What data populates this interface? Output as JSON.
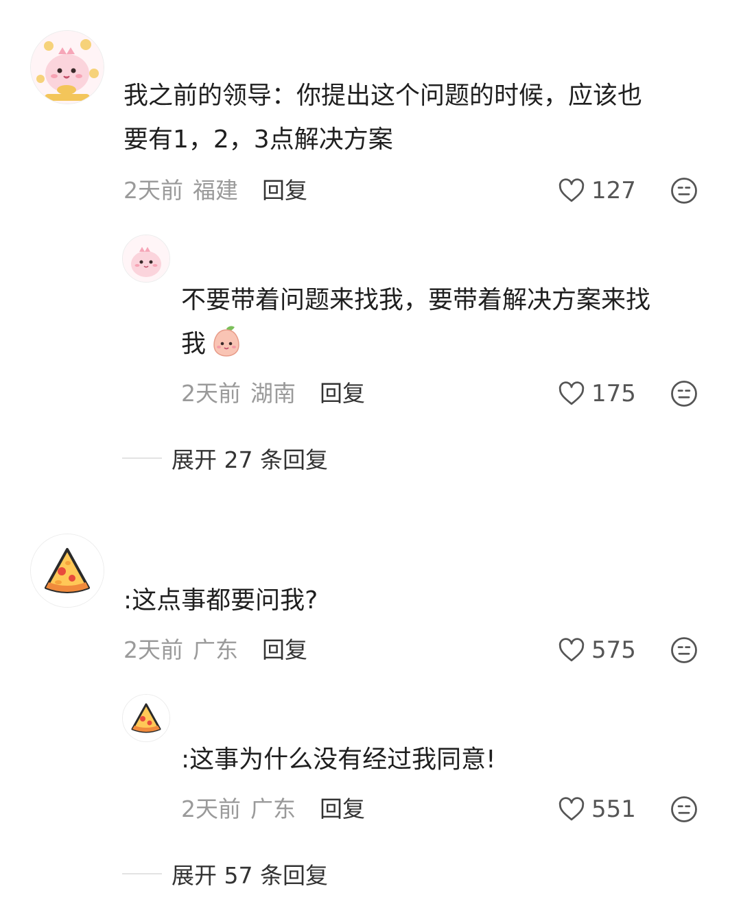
{
  "comments": [
    {
      "text_line1": "我之前的领导：你提出这个问题的时候，应该也",
      "text_line2": "要有1，2，3点解决方案",
      "time": "2天前",
      "location": "福建",
      "reply_label": "回复",
      "likes": "127",
      "avatar_icon": "pink-dino-gold-icon",
      "reply": {
        "text_line1": "不要带着问题来找我，要带着解决方案来找",
        "text_line2": "我",
        "inline_emoji": "peach-face-emoji-icon",
        "time": "2天前",
        "location": "湖南",
        "reply_label": "回复",
        "likes": "175",
        "avatar_icon": "pink-dino-icon"
      },
      "expand_label": "展开 27 条回复"
    },
    {
      "text_line1": ":这点事都要问我?",
      "time": "2天前",
      "location": "广东",
      "reply_label": "回复",
      "likes": "575",
      "avatar_icon": "pizza-slice-icon",
      "reply": {
        "text_line1": ":这事为什么没有经过我同意!",
        "time": "2天前",
        "location": "广东",
        "reply_label": "回复",
        "likes": "551",
        "avatar_icon": "pizza-slice-icon"
      },
      "expand_label": "展开 57 条回复"
    }
  ],
  "colors": {
    "text": "#1f1f1f",
    "meta": "#9a9a9a",
    "icon": "#555555",
    "divider": "#e3e3e3"
  }
}
